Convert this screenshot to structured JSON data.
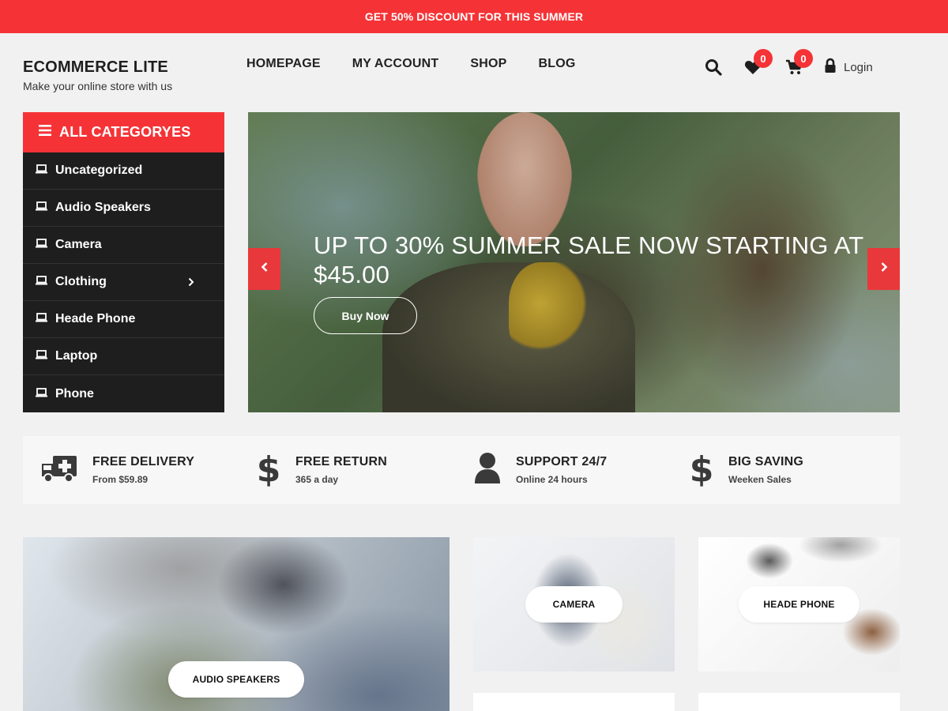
{
  "promo": {
    "text": "GET 50% DISCOUNT FOR THIS SUMMER"
  },
  "brand": {
    "title": "ECOMMERCE LITE",
    "tagline": "Make your online store with us"
  },
  "nav": {
    "items": [
      "HOMEPAGE",
      "MY ACCOUNT",
      "SHOP",
      "BLOG"
    ]
  },
  "header": {
    "wishlist_count": "0",
    "cart_count": "0",
    "login_label": "Login"
  },
  "categories": {
    "heading": "ALL CATEGORYES",
    "items": [
      "Uncategorized",
      "Audio Speakers",
      "Camera",
      "Clothing",
      "Heade Phone",
      "Laptop",
      "Phone"
    ]
  },
  "hero": {
    "title": "UP TO 30% SUMMER SALE NOW STARTING AT $45.00",
    "button": "Buy Now"
  },
  "features": [
    {
      "title": "FREE DELIVERY",
      "sub": "From $59.89",
      "icon": "ambulance-icon"
    },
    {
      "title": "FREE RETURN",
      "sub": "365 a day",
      "icon": "dollar-icon"
    },
    {
      "title": "SUPPORT 24/7",
      "sub": "Online 24 hours",
      "icon": "user-icon"
    },
    {
      "title": "BIG SAVING",
      "sub": "Weeken Sales",
      "icon": "dollar-icon"
    }
  ],
  "tiles": {
    "audio": "AUDIO SPEAKERS",
    "camera": "CAMERA",
    "headphone": "HEADE PHONE"
  },
  "colors": {
    "accent": "#f53336",
    "sidebar_bg": "#1e1e1e"
  }
}
